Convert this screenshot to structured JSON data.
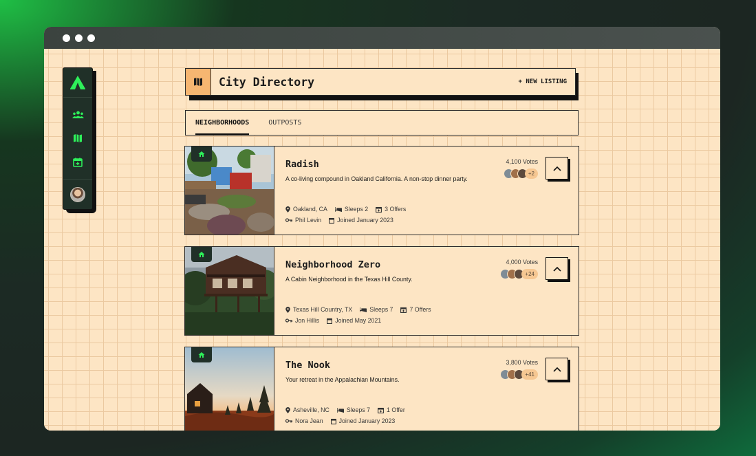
{
  "window": {
    "controls": [
      "close",
      "minimize",
      "maximize"
    ]
  },
  "sidebar": {
    "logo_icon": "tent-icon",
    "items": [
      {
        "name": "community",
        "icon": "users-icon"
      },
      {
        "name": "map",
        "icon": "map-icon"
      },
      {
        "name": "calendar",
        "icon": "calendar-add-icon"
      }
    ],
    "accent_color": "#2ef05a"
  },
  "header": {
    "title": "City Directory",
    "new_listing_label": "+ NEW LISTING",
    "icon": "map-icon"
  },
  "tabs": [
    {
      "label": "NEIGHBORHOODS",
      "active": true
    },
    {
      "label": "OUTPOSTS",
      "active": false
    }
  ],
  "listings": [
    {
      "title": "Radish",
      "description": "A co-living compound in Oakland California. A non-stop dinner party.",
      "votes": "4,100 Votes",
      "voter_extra": "+2",
      "location": "Oakland, CA",
      "sleeps": "Sleeps 2",
      "offers": "3 Offers",
      "host": "Phil Levin",
      "joined": "Joined January 2023",
      "image": "backyard-garden-photo"
    },
    {
      "title": "Neighborhood Zero",
      "description": "A Cabin Neighborhood in the Texas Hill County.",
      "votes": "4,000 Votes",
      "voter_extra": "+24",
      "location": "Texas Hill Country, TX",
      "sleeps": "Sleeps 7",
      "offers": "7 Offers",
      "host": "Jon Hillis",
      "joined": "Joined May 2021",
      "image": "forest-cabin-photo"
    },
    {
      "title": "The Nook",
      "description": "Your retreat in the Appalachian Mountains.",
      "votes": "3,800 Votes",
      "voter_extra": "+41",
      "location": "Asheville, NC",
      "sleeps": "Sleeps 7",
      "offers": "1 Offer",
      "host": "Nora Jean",
      "joined": "Joined January 2023",
      "image": "mountain-sunset-cabin-photo"
    }
  ]
}
